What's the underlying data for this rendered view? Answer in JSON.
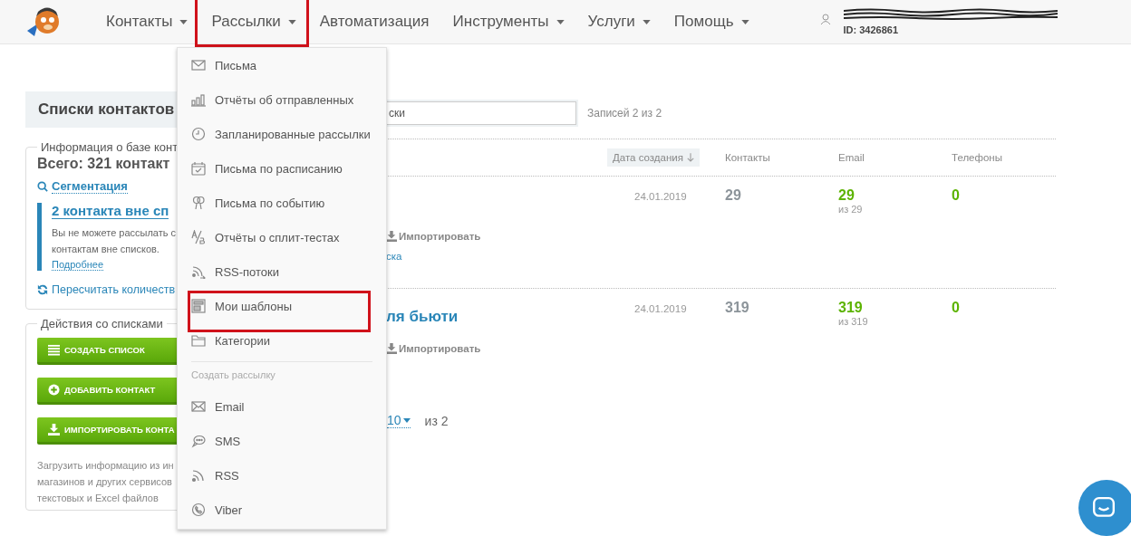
{
  "header": {
    "nav": [
      {
        "label": "Контакты",
        "dropdown": true,
        "annotated": false
      },
      {
        "label": "Рассылки",
        "dropdown": true,
        "annotated": true
      },
      {
        "label": "Автоматизация",
        "dropdown": false,
        "annotated": false
      },
      {
        "label": "Инструменты",
        "dropdown": true,
        "annotated": false
      },
      {
        "label": "Услуги",
        "dropdown": true,
        "annotated": false
      },
      {
        "label": "Помощь",
        "dropdown": true,
        "annotated": false
      }
    ],
    "account": {
      "id": "ID: 3426861"
    }
  },
  "sidebar": {
    "title": "Списки контактов",
    "info": {
      "legend": "Информация о базе конт",
      "total": "Всего: 321 контакт",
      "segmentation": "Сегментация",
      "notice": {
        "title": "2 контакта вне сп",
        "lines": [
          "Вы не можете рассылать с",
          "контактам вне списков."
        ],
        "link": "Подробнее"
      },
      "recount": "Пересчитать количеств"
    },
    "actions": {
      "legend": "Действия со списками",
      "buttons": [
        {
          "label": "СОЗДАТЬ СПИСОК"
        },
        {
          "label": "ДОБАВИТЬ КОНТАКТ"
        },
        {
          "label": "ИМПОРТИРОВАТЬ КОНТА"
        }
      ],
      "description": [
        "Загрузить информацию из ин",
        "магазинов и других сервисов",
        "текстовых и Excel файлов"
      ]
    }
  },
  "menu": {
    "items": [
      {
        "label": "Письма",
        "annotated": false
      },
      {
        "label": "Отчёты об отправленных",
        "annotated": false
      },
      {
        "label": "Запланированные рассылки",
        "annotated": false
      },
      {
        "label": "Письма по расписанию",
        "annotated": false
      },
      {
        "label": "Письма по событию",
        "annotated": false
      },
      {
        "label": "Отчёты о сплит-тестах",
        "annotated": false
      },
      {
        "label": "RSS-потоки",
        "annotated": false
      },
      {
        "label": "Мои шаблоны",
        "annotated": true
      },
      {
        "label": "Категории",
        "annotated": false
      }
    ],
    "section_title": "Создать рассылку",
    "section_items": [
      {
        "label": "Email",
        "annotated": false
      },
      {
        "label": "SMS",
        "annotated": false
      },
      {
        "label": "RSS",
        "annotated": false
      },
      {
        "label": "Viber",
        "annotated": false
      }
    ]
  },
  "lists": {
    "search": {
      "value": "ски"
    },
    "count": "Записей 2 из 2",
    "columns": [
      {
        "label": "Дата создания",
        "sorted": true
      },
      {
        "label": "Контакты",
        "sorted": false
      },
      {
        "label": "Email",
        "sorted": false
      },
      {
        "label": "Телефоны",
        "sorted": false
      }
    ],
    "rows": [
      {
        "action": "Импортировать",
        "link": "ска",
        "date": "24.01.2019",
        "contacts": "29",
        "email": "29",
        "email_total": "из 29",
        "phones": "0"
      },
      {
        "name": "ля бьюти",
        "action": "Импортировать",
        "date": "24.01.2019",
        "contacts": "319",
        "email": "319",
        "email_total": "из 319",
        "phones": "0"
      }
    ],
    "pagination": {
      "page_size": "10",
      "total": "из 2"
    }
  }
}
